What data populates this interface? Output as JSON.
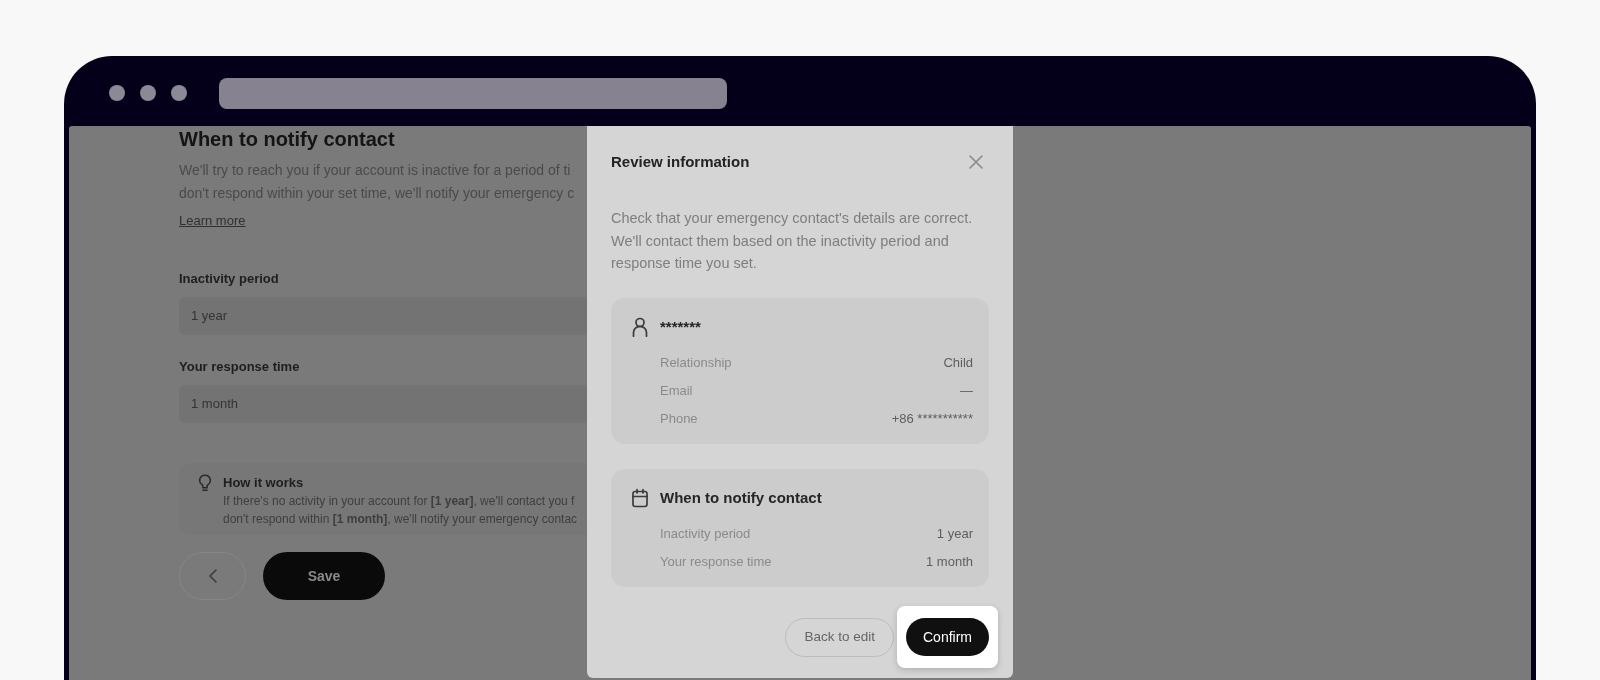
{
  "page": {
    "heading": "When to notify contact",
    "intro_lines": [
      "We'll try to reach you if your account is inactive for a period of ti",
      "don't respond within your set time, we'll notify your emergency c"
    ],
    "learn_more": "Learn more",
    "fields": [
      {
        "label": "Inactivity period",
        "value": "1 year"
      },
      {
        "label": "Your response time",
        "value": "1 month"
      }
    ],
    "info": {
      "title": "How it works",
      "lines": [
        "If there's no activity in your account for **[1 year]**, we'll contact you f",
        "don't respond within **[1 month]**, we'll notify your emergency contac"
      ]
    },
    "buttons": [
      {
        "kind": "back"
      },
      {
        "kind": "primary",
        "label": "Save"
      }
    ]
  },
  "modal": {
    "title": "Review information",
    "description": "Check that your emergency contact's details are correct. We'll contact them based on the inactivity period and response time you set.",
    "sections": [
      {
        "kind": "contact",
        "title": "*******",
        "rows": [
          {
            "label": "Relationship",
            "value": "Child"
          },
          {
            "label": "Email",
            "value": "—"
          },
          {
            "label": "Phone",
            "value": "+86 ***********"
          }
        ]
      },
      {
        "kind": "schedule",
        "title": "When to notify contact",
        "rows": [
          {
            "label": "Inactivity period",
            "value": "1 year"
          },
          {
            "label": "Your response time",
            "value": "1 month"
          }
        ]
      }
    ],
    "buttons": [
      {
        "kind": "secondary",
        "label": "Back to edit",
        "highlighted": false
      },
      {
        "kind": "primary",
        "label": "Confirm",
        "highlighted": true
      }
    ]
  }
}
